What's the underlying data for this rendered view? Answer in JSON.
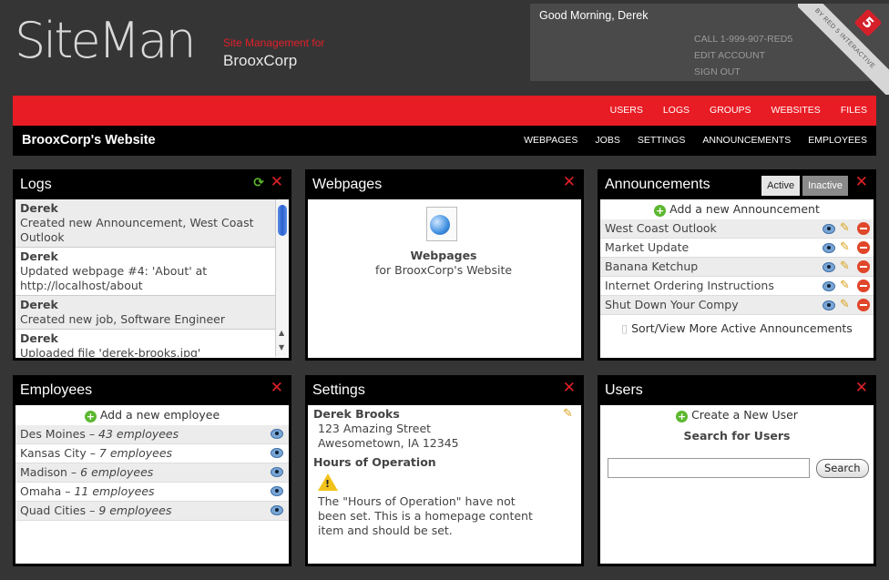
{
  "brand": {
    "logo": "SiteMan",
    "tagline_top": "Site Management for",
    "tagline_company": "BrooxCorp",
    "ribbon_text": "BY RED 5 INTERACTIVE",
    "ribbon_mark": "5"
  },
  "account": {
    "greeting": "Good Morning, Derek",
    "phone": "CALL 1-999-907-RED5",
    "edit": "EDIT ACCOUNT",
    "signout": "SIGN OUT"
  },
  "topnav": [
    "USERS",
    "LOGS",
    "GROUPS",
    "WEBSITES",
    "FILES"
  ],
  "subbar": {
    "title": "BrooxCorp's Website",
    "nav": [
      "WEBPAGES",
      "JOBS",
      "SETTINGS",
      "ANNOUNCEMENTS",
      "EMPLOYEES"
    ]
  },
  "logs": {
    "title": "Logs",
    "entries": [
      {
        "user": "Derek",
        "text": "Created new Announcement, West Coast Outlook"
      },
      {
        "user": "Derek",
        "text": "Updated webpage #4: 'About' at http://localhost/about"
      },
      {
        "user": "Derek",
        "text": "Created new job, Software Engineer"
      },
      {
        "user": "Derek",
        "text": "Uploaded file 'derek-brooks.jpg'"
      }
    ]
  },
  "webpages": {
    "title": "Webpages",
    "label": "Webpages",
    "sublabel": "for BrooxCorp's Website"
  },
  "announcements": {
    "title": "Announcements",
    "tab_active": "Active",
    "tab_inactive": "Inactive",
    "add": "Add a new Announcement",
    "items": [
      "West Coast Outlook",
      "Market Update",
      "Banana Ketchup",
      "Internet Ordering Instructions",
      "Shut Down Your Compy"
    ],
    "more": "Sort/View More Active Announcements"
  },
  "employees": {
    "title": "Employees",
    "add": "Add a new employee",
    "items": [
      {
        "city": "Des Moines",
        "count": "43 employees"
      },
      {
        "city": "Kansas City",
        "count": "7 employees"
      },
      {
        "city": "Madison",
        "count": "6 employees"
      },
      {
        "city": "Omaha",
        "count": "11 employees"
      },
      {
        "city": "Quad Cities",
        "count": "9 employees"
      }
    ]
  },
  "settings": {
    "title": "Settings",
    "name": "Derek Brooks",
    "address1": "123 Amazing Street",
    "address2": "Awesometown, IA 12345",
    "hours_heading": "Hours of Operation",
    "hours_note": "The \"Hours of Operation\" have not been set. This is a homepage content item and should be set."
  },
  "users": {
    "title": "Users",
    "create": "Create a New User",
    "search_heading": "Search for Users",
    "search_button": "Search",
    "search_value": ""
  }
}
